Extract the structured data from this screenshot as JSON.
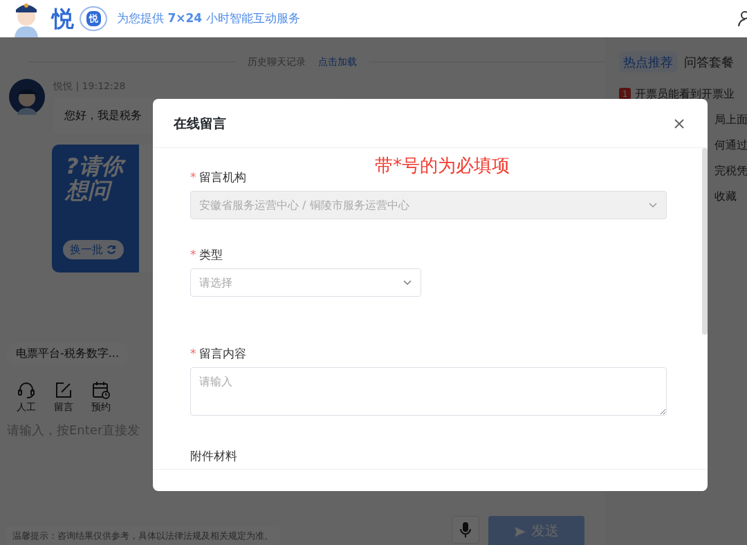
{
  "header": {
    "brand": "悦",
    "badge": "悦",
    "slogan": "为您提供 **7×24** 小时智能互动服务"
  },
  "chat": {
    "history_label": "历史聊天记录",
    "history_link": "点击加载",
    "message": {
      "sender_line": "悦悦 | 19:12:28",
      "text": "您好，我是税务"
    },
    "question_card": {
      "title_lines": [
        "?请你",
        "想问"
      ],
      "refresh_button": "换一批"
    },
    "quick_chip": "电票平台-税务数字...",
    "tools": [
      {
        "label": "人工",
        "kind": "headset"
      },
      {
        "label": "留言",
        "kind": "edit"
      },
      {
        "label": "预约",
        "kind": "calendar"
      }
    ],
    "input": {
      "placeholder": "请输入，按Enter直接发"
    },
    "tip": "温馨提示：咨询结果仅供参考，具体以法律法规及相关规定为准。",
    "send_button": "发送"
  },
  "sidebar": {
    "tabs": [
      {
        "label": "热点推荐",
        "selected": true
      },
      {
        "label": "问答套餐",
        "selected": false
      }
    ],
    "items": [
      {
        "rank": "1",
        "text": "开票员能看到开票业"
      },
      {
        "text": "局上面"
      },
      {
        "text": "何通过"
      },
      {
        "text": "完税凭"
      },
      {
        "text": "收藏"
      }
    ]
  },
  "dialog": {
    "title": "在线留言",
    "note": "带*号的为必填项",
    "required_mark": "*",
    "fields": [
      {
        "label": "留言机构",
        "required": true,
        "kind": "select",
        "value": "安徽省服务运营中心 / 铜陵市服务运营中心",
        "disabled": true
      },
      {
        "label": "类型",
        "required": true,
        "kind": "select",
        "placeholder": "请选择",
        "disabled": false
      },
      {
        "label": "留言内容",
        "required": true,
        "kind": "textarea",
        "placeholder": "请输入"
      },
      {
        "label": "附件材料",
        "required": false,
        "kind": "upload"
      }
    ]
  }
}
